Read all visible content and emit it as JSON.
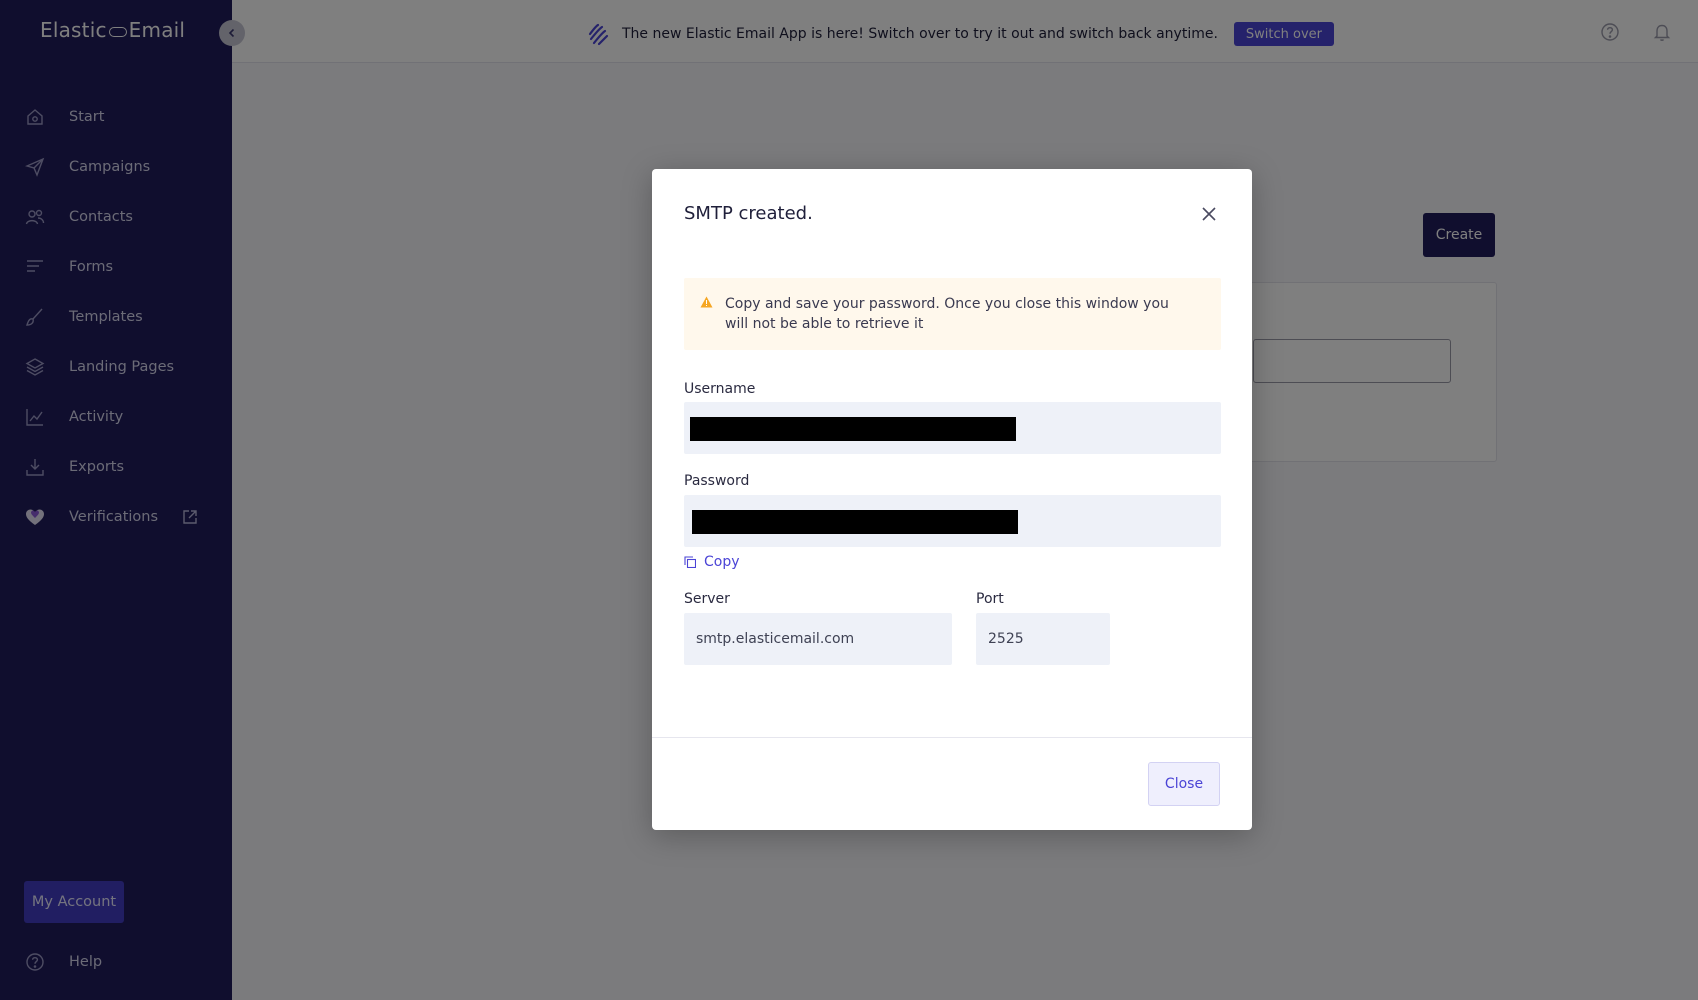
{
  "app": {
    "logo_left": "Elastic",
    "logo_right": "Email"
  },
  "sidebar": {
    "items": [
      {
        "label": "Start",
        "icon": "home-icon"
      },
      {
        "label": "Campaigns",
        "icon": "paper-plane-icon"
      },
      {
        "label": "Contacts",
        "icon": "users-icon"
      },
      {
        "label": "Forms",
        "icon": "form-lines-icon"
      },
      {
        "label": "Templates",
        "icon": "brush-icon"
      },
      {
        "label": "Landing Pages",
        "icon": "layers-icon"
      },
      {
        "label": "Activity",
        "icon": "chart-icon"
      },
      {
        "label": "Exports",
        "icon": "download-icon"
      },
      {
        "label": "Verifications",
        "icon": "heart-icon"
      }
    ],
    "my_account_label": "My Account",
    "help_label": "Help"
  },
  "topbar": {
    "banner_text": "The new Elastic Email App is here! Switch over to try it out and switch back anytime.",
    "switch_label": "Switch over"
  },
  "background": {
    "create_label": "Create"
  },
  "modal": {
    "title": "SMTP created.",
    "alert_text": "Copy and save your password. Once you close this window you will not be able to retrieve it",
    "username_label": "Username",
    "password_label": "Password",
    "copy_label": "Copy",
    "server_label": "Server",
    "server_value": "smtp.elasticemail.com",
    "port_label": "Port",
    "port_value": "2525",
    "close_label": "Close"
  },
  "colors": {
    "sidebar_bg": "#201c5c",
    "accent": "#4b44d6",
    "alert_bg": "#fff8ec",
    "warning": "#f5a623"
  }
}
